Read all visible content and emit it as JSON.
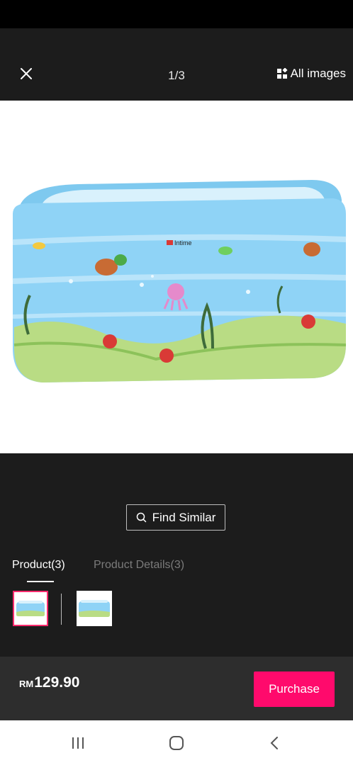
{
  "header": {
    "counter": "1/3",
    "all_images_label": "All images"
  },
  "product_image": {
    "brand_text": "Intime"
  },
  "find_similar": {
    "label": "Find Similar"
  },
  "tabs": [
    {
      "label": "Product(3)",
      "active": true
    },
    {
      "label": "Product Details(3)",
      "active": false
    }
  ],
  "thumbnails": {
    "selected_index": 0
  },
  "footer": {
    "currency": "RM",
    "price": "129.90",
    "purchase_label": "Purchase"
  },
  "colors": {
    "accent": "#ff0a6c",
    "pool": "#8fd3f6",
    "dark_bg": "#1c1c1c"
  },
  "icons": [
    "close-icon",
    "gallery-icon",
    "search-icon",
    "recents-icon",
    "home-icon",
    "back-icon"
  ]
}
